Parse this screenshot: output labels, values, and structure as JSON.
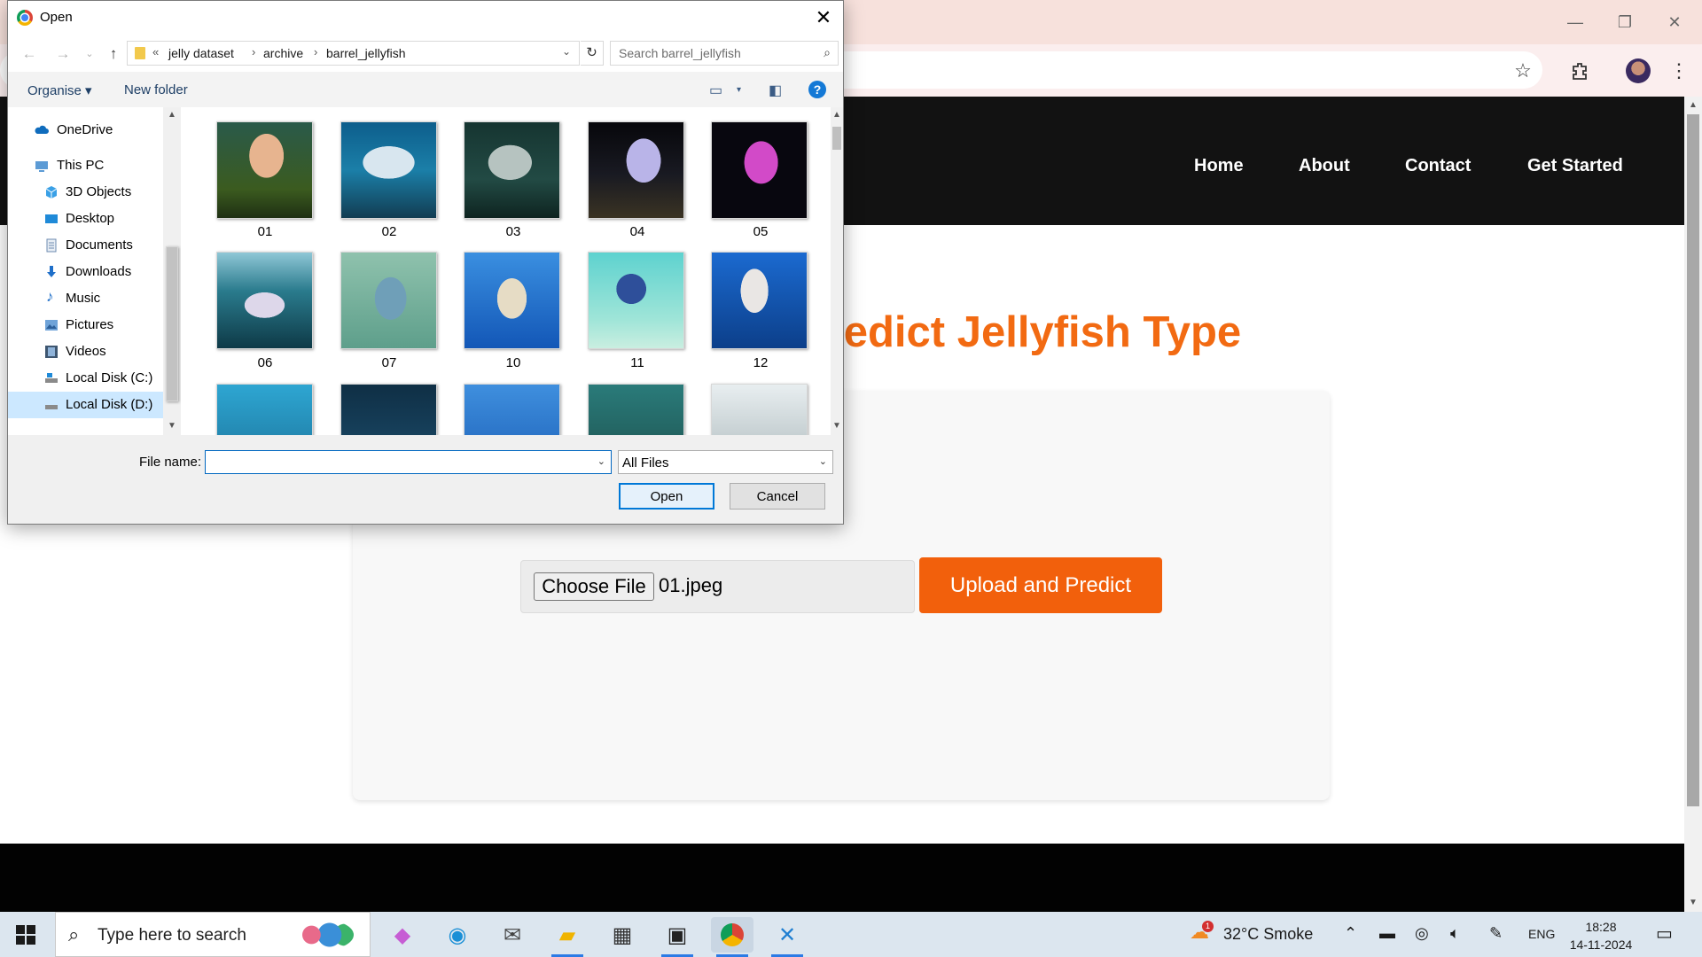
{
  "browser": {
    "window_controls": {
      "minimize": "—",
      "restore": "❐",
      "close": "✕"
    }
  },
  "website": {
    "nav": [
      "Home",
      "About",
      "Contact",
      "Get Started"
    ],
    "title": "Predict Jellyfish Type",
    "file_input": {
      "button": "Choose File",
      "chosen": "01.jpeg"
    },
    "upload_button": "Upload and Predict",
    "accent_color": "#f26a12"
  },
  "dialog": {
    "title": "Open",
    "breadcrumb": [
      "jelly dataset",
      "archive",
      "barrel_jellyfish"
    ],
    "search_placeholder": "Search barrel_jellyfish",
    "commands": {
      "organise": "Organise ▾",
      "new_folder": "New folder",
      "help": "?"
    },
    "nav_items": [
      {
        "label": "OneDrive",
        "icon": "cloud-icon"
      },
      {
        "label": "This PC",
        "icon": "computer-icon"
      },
      {
        "label": "3D Objects",
        "icon": "cube-icon"
      },
      {
        "label": "Desktop",
        "icon": "desktop-icon"
      },
      {
        "label": "Documents",
        "icon": "document-icon"
      },
      {
        "label": "Downloads",
        "icon": "download-icon"
      },
      {
        "label": "Music",
        "icon": "music-icon"
      },
      {
        "label": "Pictures",
        "icon": "pictures-icon"
      },
      {
        "label": "Videos",
        "icon": "video-icon"
      },
      {
        "label": "Local Disk (C:)",
        "icon": "drive-icon"
      },
      {
        "label": "Local Disk (D:)",
        "icon": "drive-icon",
        "selected": true
      }
    ],
    "files": [
      "01",
      "02",
      "03",
      "04",
      "05",
      "06",
      "07",
      "10",
      "11",
      "12",
      "",
      "",
      "",
      "",
      ""
    ],
    "file_name_label": "File name:",
    "file_name_value": "",
    "file_type": "All Files",
    "open_button": "Open",
    "cancel_button": "Cancel"
  },
  "taskbar": {
    "search_placeholder": "Type here to search",
    "weather": "32°C  Smoke",
    "weather_badge": "1",
    "language": "ENG",
    "time": "18:28",
    "date": "14-11-2024"
  }
}
